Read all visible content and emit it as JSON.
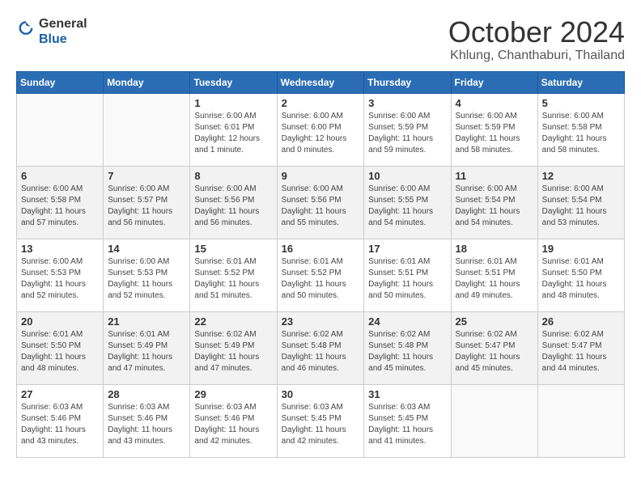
{
  "logo": {
    "general": "General",
    "blue": "Blue"
  },
  "header": {
    "month_year": "October 2024",
    "location": "Khlung, Chanthaburi, Thailand"
  },
  "weekdays": [
    "Sunday",
    "Monday",
    "Tuesday",
    "Wednesday",
    "Thursday",
    "Friday",
    "Saturday"
  ],
  "days": [
    {
      "date": "",
      "info": ""
    },
    {
      "date": "",
      "info": ""
    },
    {
      "date": "1",
      "info": "Sunrise: 6:00 AM\nSunset: 6:01 PM\nDaylight: 12 hours\nand 1 minute."
    },
    {
      "date": "2",
      "info": "Sunrise: 6:00 AM\nSunset: 6:00 PM\nDaylight: 12 hours\nand 0 minutes."
    },
    {
      "date": "3",
      "info": "Sunrise: 6:00 AM\nSunset: 5:59 PM\nDaylight: 11 hours\nand 59 minutes."
    },
    {
      "date": "4",
      "info": "Sunrise: 6:00 AM\nSunset: 5:59 PM\nDaylight: 11 hours\nand 58 minutes."
    },
    {
      "date": "5",
      "info": "Sunrise: 6:00 AM\nSunset: 5:58 PM\nDaylight: 11 hours\nand 58 minutes."
    },
    {
      "date": "6",
      "info": "Sunrise: 6:00 AM\nSunset: 5:58 PM\nDaylight: 11 hours\nand 57 minutes."
    },
    {
      "date": "7",
      "info": "Sunrise: 6:00 AM\nSunset: 5:57 PM\nDaylight: 11 hours\nand 56 minutes."
    },
    {
      "date": "8",
      "info": "Sunrise: 6:00 AM\nSunset: 5:56 PM\nDaylight: 11 hours\nand 56 minutes."
    },
    {
      "date": "9",
      "info": "Sunrise: 6:00 AM\nSunset: 5:56 PM\nDaylight: 11 hours\nand 55 minutes."
    },
    {
      "date": "10",
      "info": "Sunrise: 6:00 AM\nSunset: 5:55 PM\nDaylight: 11 hours\nand 54 minutes."
    },
    {
      "date": "11",
      "info": "Sunrise: 6:00 AM\nSunset: 5:54 PM\nDaylight: 11 hours\nand 54 minutes."
    },
    {
      "date": "12",
      "info": "Sunrise: 6:00 AM\nSunset: 5:54 PM\nDaylight: 11 hours\nand 53 minutes."
    },
    {
      "date": "13",
      "info": "Sunrise: 6:00 AM\nSunset: 5:53 PM\nDaylight: 11 hours\nand 52 minutes."
    },
    {
      "date": "14",
      "info": "Sunrise: 6:00 AM\nSunset: 5:53 PM\nDaylight: 11 hours\nand 52 minutes."
    },
    {
      "date": "15",
      "info": "Sunrise: 6:01 AM\nSunset: 5:52 PM\nDaylight: 11 hours\nand 51 minutes."
    },
    {
      "date": "16",
      "info": "Sunrise: 6:01 AM\nSunset: 5:52 PM\nDaylight: 11 hours\nand 50 minutes."
    },
    {
      "date": "17",
      "info": "Sunrise: 6:01 AM\nSunset: 5:51 PM\nDaylight: 11 hours\nand 50 minutes."
    },
    {
      "date": "18",
      "info": "Sunrise: 6:01 AM\nSunset: 5:51 PM\nDaylight: 11 hours\nand 49 minutes."
    },
    {
      "date": "19",
      "info": "Sunrise: 6:01 AM\nSunset: 5:50 PM\nDaylight: 11 hours\nand 48 minutes."
    },
    {
      "date": "20",
      "info": "Sunrise: 6:01 AM\nSunset: 5:50 PM\nDaylight: 11 hours\nand 48 minutes."
    },
    {
      "date": "21",
      "info": "Sunrise: 6:01 AM\nSunset: 5:49 PM\nDaylight: 11 hours\nand 47 minutes."
    },
    {
      "date": "22",
      "info": "Sunrise: 6:02 AM\nSunset: 5:49 PM\nDaylight: 11 hours\nand 47 minutes."
    },
    {
      "date": "23",
      "info": "Sunrise: 6:02 AM\nSunset: 5:48 PM\nDaylight: 11 hours\nand 46 minutes."
    },
    {
      "date": "24",
      "info": "Sunrise: 6:02 AM\nSunset: 5:48 PM\nDaylight: 11 hours\nand 45 minutes."
    },
    {
      "date": "25",
      "info": "Sunrise: 6:02 AM\nSunset: 5:47 PM\nDaylight: 11 hours\nand 45 minutes."
    },
    {
      "date": "26",
      "info": "Sunrise: 6:02 AM\nSunset: 5:47 PM\nDaylight: 11 hours\nand 44 minutes."
    },
    {
      "date": "27",
      "info": "Sunrise: 6:03 AM\nSunset: 5:46 PM\nDaylight: 11 hours\nand 43 minutes."
    },
    {
      "date": "28",
      "info": "Sunrise: 6:03 AM\nSunset: 5:46 PM\nDaylight: 11 hours\nand 43 minutes."
    },
    {
      "date": "29",
      "info": "Sunrise: 6:03 AM\nSunset: 5:46 PM\nDaylight: 11 hours\nand 42 minutes."
    },
    {
      "date": "30",
      "info": "Sunrise: 6:03 AM\nSunset: 5:45 PM\nDaylight: 11 hours\nand 42 minutes."
    },
    {
      "date": "31",
      "info": "Sunrise: 6:03 AM\nSunset: 5:45 PM\nDaylight: 11 hours\nand 41 minutes."
    },
    {
      "date": "",
      "info": ""
    },
    {
      "date": "",
      "info": ""
    }
  ]
}
